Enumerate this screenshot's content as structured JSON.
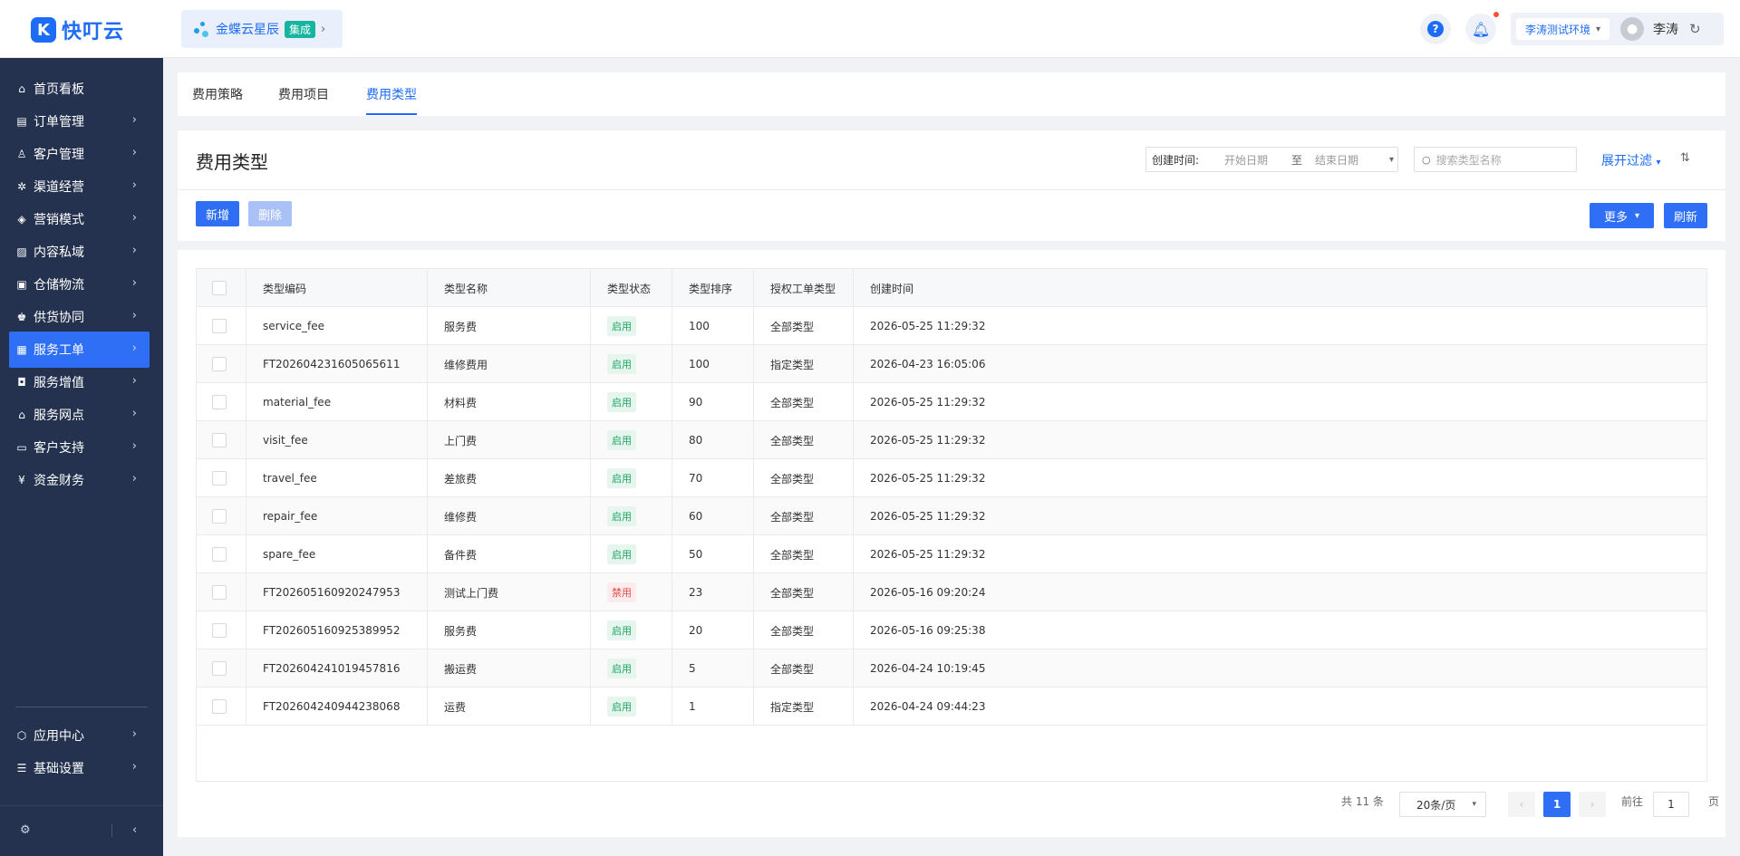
{
  "header": {
    "logo_mark": "K",
    "logo_text": "快叮云",
    "integration_label": "金蝶云星辰",
    "integration_badge": "集成",
    "environment": "李涛测试环境",
    "user_name": "李涛"
  },
  "sidebar": {
    "items": [
      {
        "label": "首页看板",
        "icon": "home-icon",
        "glyph": "⌂",
        "has_arrow": false
      },
      {
        "label": "订单管理",
        "icon": "order-icon",
        "glyph": "▤",
        "has_arrow": true
      },
      {
        "label": "客户管理",
        "icon": "user-icon",
        "glyph": "♙",
        "has_arrow": true
      },
      {
        "label": "渠道经营",
        "icon": "channel-icon",
        "glyph": "✲",
        "has_arrow": true
      },
      {
        "label": "营销模式",
        "icon": "tag-icon",
        "glyph": "◈",
        "has_arrow": true
      },
      {
        "label": "内容私域",
        "icon": "image-icon",
        "glyph": "▨",
        "has_arrow": true
      },
      {
        "label": "仓储物流",
        "icon": "warehouse-icon",
        "glyph": "▣",
        "has_arrow": true
      },
      {
        "label": "供货协同",
        "icon": "supply-icon",
        "glyph": "♚",
        "has_arrow": true
      },
      {
        "label": "服务工单",
        "icon": "workorder-icon",
        "glyph": "▦",
        "has_arrow": true,
        "active": true
      },
      {
        "label": "服务增值",
        "icon": "bag-icon",
        "glyph": "◘",
        "has_arrow": true
      },
      {
        "label": "服务网点",
        "icon": "store-icon",
        "glyph": "⌂",
        "has_arrow": true
      },
      {
        "label": "客户支持",
        "icon": "support-icon",
        "glyph": "▭",
        "has_arrow": true
      },
      {
        "label": "资金财务",
        "icon": "finance-icon",
        "glyph": "¥",
        "has_arrow": true
      }
    ],
    "bottom_items": [
      {
        "label": "应用中心",
        "icon": "app-center-icon",
        "glyph": "⬡"
      },
      {
        "label": "基础设置",
        "icon": "settings-list-icon",
        "glyph": "☰"
      }
    ]
  },
  "tabs": [
    {
      "label": "费用策略",
      "active": false
    },
    {
      "label": "费用项目",
      "active": false
    },
    {
      "label": "费用类型",
      "active": true
    }
  ],
  "page": {
    "title": "费用类型",
    "date_label": "创建时间:",
    "date_start_placeholder": "开始日期",
    "date_to": "至",
    "date_end_placeholder": "结束日期",
    "search_placeholder": "搜索类型名称",
    "expand_filter": "展开过滤",
    "add_button": "新增",
    "delete_button": "删除",
    "more_button": "更多",
    "refresh_button": "刷新"
  },
  "table": {
    "columns": [
      "类型编码",
      "类型名称",
      "类型状态",
      "类型排序",
      "授权工单类型",
      "创建时间"
    ],
    "rows": [
      {
        "code": "service_fee",
        "name": "服务费",
        "status": "启用",
        "enabled": true,
        "sort": "100",
        "auth": "全部类型",
        "created": "2026-05-25 11:29:32"
      },
      {
        "code": "FT202604231605065611",
        "name": "维修费用",
        "status": "启用",
        "enabled": true,
        "sort": "100",
        "auth": "指定类型",
        "created": "2026-04-23 16:05:06"
      },
      {
        "code": "material_fee",
        "name": "材料费",
        "status": "启用",
        "enabled": true,
        "sort": "90",
        "auth": "全部类型",
        "created": "2026-05-25 11:29:32"
      },
      {
        "code": "visit_fee",
        "name": "上门费",
        "status": "启用",
        "enabled": true,
        "sort": "80",
        "auth": "全部类型",
        "created": "2026-05-25 11:29:32"
      },
      {
        "code": "travel_fee",
        "name": "差旅费",
        "status": "启用",
        "enabled": true,
        "sort": "70",
        "auth": "全部类型",
        "created": "2026-05-25 11:29:32"
      },
      {
        "code": "repair_fee",
        "name": "维修费",
        "status": "启用",
        "enabled": true,
        "sort": "60",
        "auth": "全部类型",
        "created": "2026-05-25 11:29:32"
      },
      {
        "code": "spare_fee",
        "name": "备件费",
        "status": "启用",
        "enabled": true,
        "sort": "50",
        "auth": "全部类型",
        "created": "2026-05-25 11:29:32"
      },
      {
        "code": "FT202605160920247953",
        "name": "测试上门费",
        "status": "禁用",
        "enabled": false,
        "sort": "23",
        "auth": "全部类型",
        "created": "2026-05-16 09:20:24"
      },
      {
        "code": "FT202605160925389952",
        "name": "服务费",
        "status": "启用",
        "enabled": true,
        "sort": "20",
        "auth": "全部类型",
        "created": "2026-05-16 09:25:38"
      },
      {
        "code": "FT202604241019457816",
        "name": "搬运费",
        "status": "启用",
        "enabled": true,
        "sort": "5",
        "auth": "全部类型",
        "created": "2026-04-24 10:19:45"
      },
      {
        "code": "FT202604240944238068",
        "name": "运费",
        "status": "启用",
        "enabled": true,
        "sort": "1",
        "auth": "指定类型",
        "created": "2026-04-24 09:44:23"
      }
    ]
  },
  "pagination": {
    "total": "共 11 条",
    "page_size": "20条/页",
    "current_page": "1",
    "goto_label": "前往",
    "goto_value": "1",
    "page_unit": "页"
  },
  "colors": {
    "primary": "#2f6ff5",
    "sidebar_bg": "#24324f",
    "enabled": "#1fa464",
    "disabled": "#e14b4b"
  }
}
